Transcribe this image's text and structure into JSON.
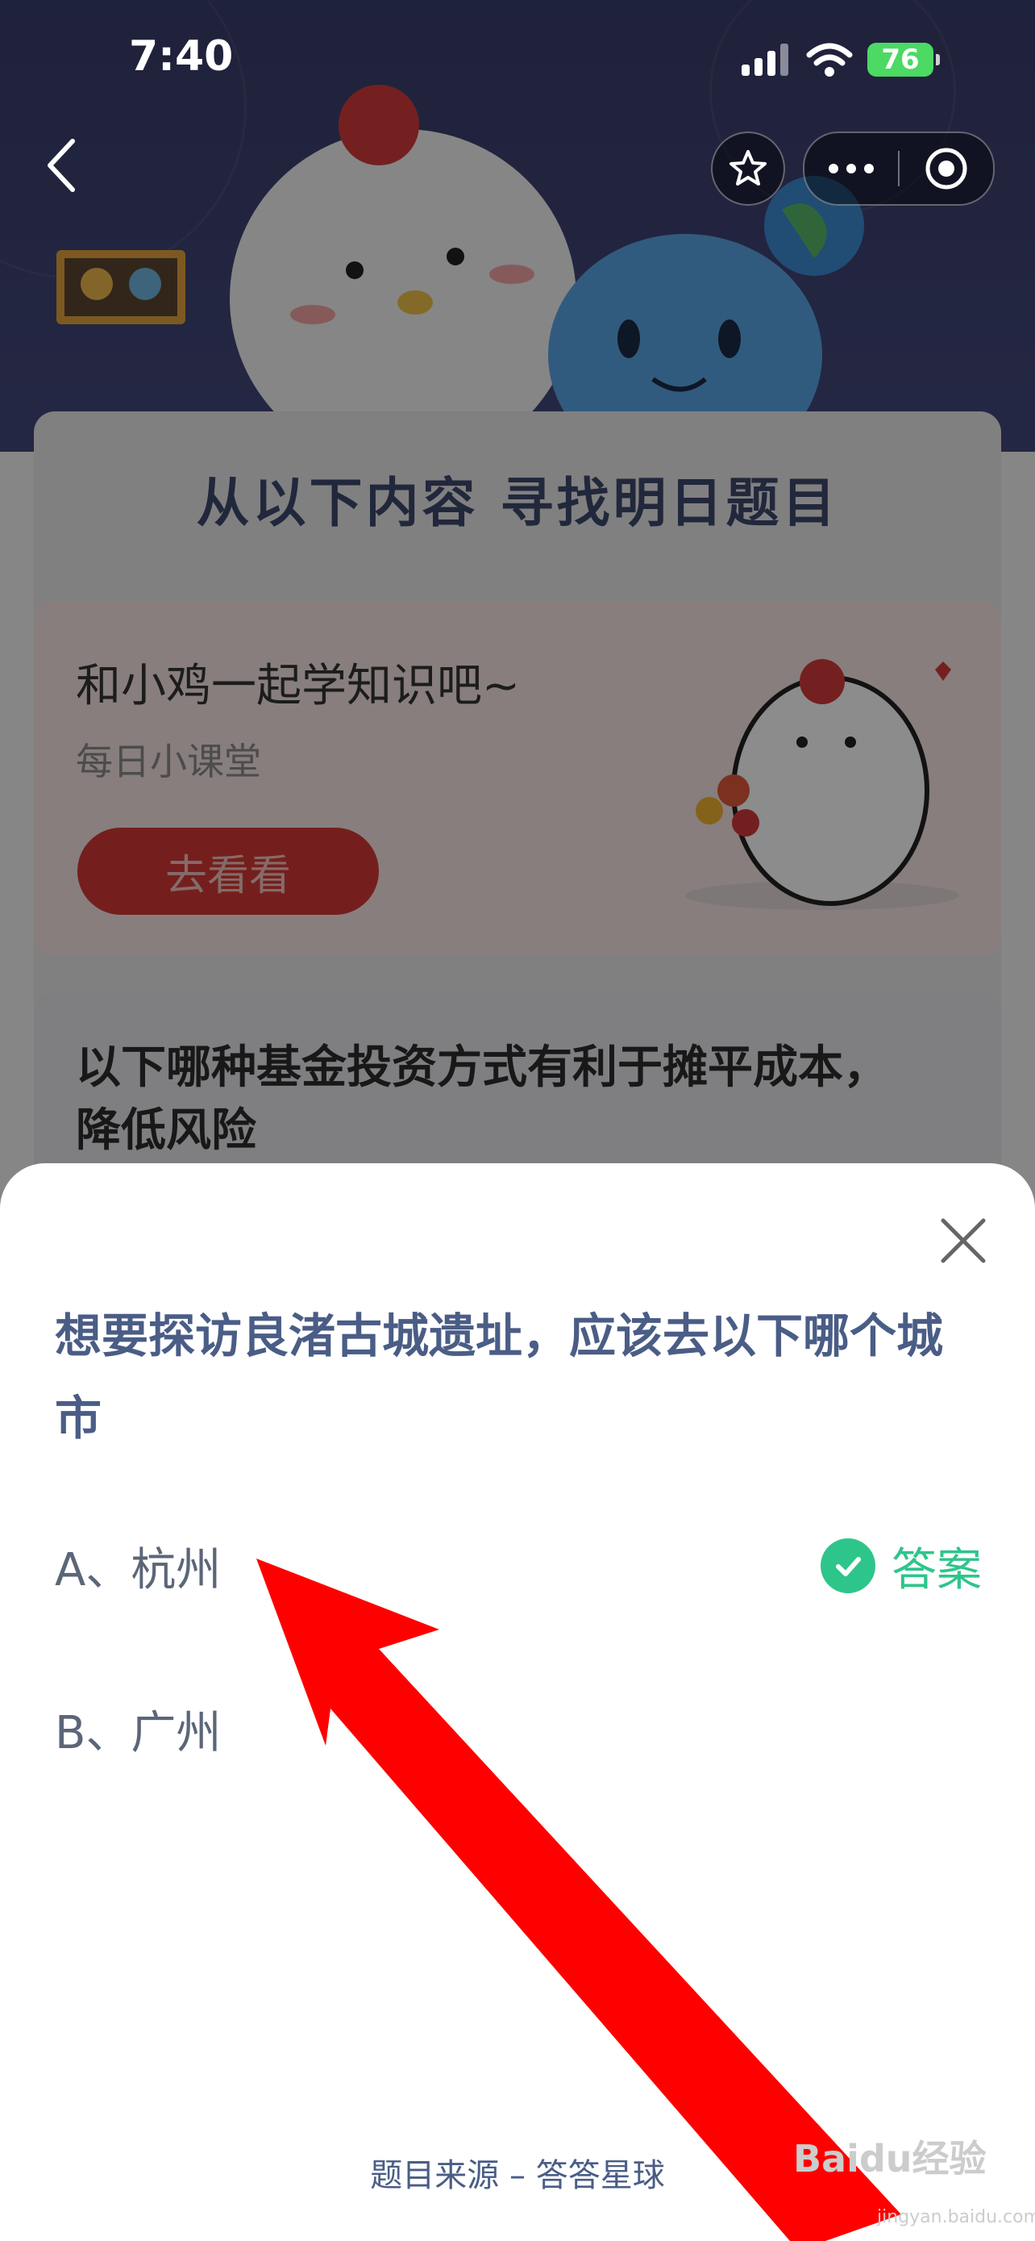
{
  "status_bar": {
    "time": "7:40",
    "battery": "76"
  },
  "nav": {
    "back_icon": "chevron-left-icon",
    "favorite_icon": "star-icon",
    "more_icon": "more-dots-icon",
    "close_mini_icon": "target-icon"
  },
  "background_page": {
    "section_title": "从以下内容 寻找明日题目",
    "lesson_card": {
      "title": "和小鸡一起学知识吧~",
      "subtitle": "每日小课堂",
      "button": "去看看"
    },
    "fund_card": {
      "question": "以下哪种基金投资方式有利于摊平成本，降低风险"
    }
  },
  "sheet": {
    "question": "想要探访良渚古城遗址，应该去以下哪个城市",
    "options": [
      {
        "label": "A、杭州",
        "answer_label": "答案"
      },
      {
        "label": "B、广州"
      }
    ],
    "source": "题目来源 – 答答星球"
  },
  "watermark": {
    "brand": "Baidu经验",
    "url": "jingyan.baidu.com"
  },
  "colors": {
    "accent_text": "#4a5d86",
    "correct_green": "#2ec58b",
    "annotation_red": "#ff0000"
  }
}
